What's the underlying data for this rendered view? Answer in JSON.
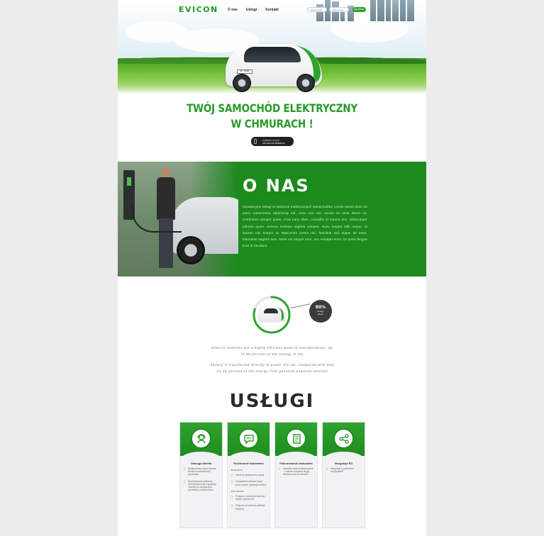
{
  "nav": {
    "logo": "EVICON",
    "menu": [
      "O nas",
      "Usługi",
      "Kontakt"
    ],
    "login_placeholder": "Nazwa użytk.",
    "password_placeholder": "Hasło użytk.",
    "login_button": "ZALOGUJ"
  },
  "hero": {
    "plate": "EV 8300",
    "headline_line1": "TWÓJ SAMOCHÓD ELEKTRYCZNY",
    "headline_line2": "W CHMURACH !",
    "app_button_line1": "POBIERZ NASZĄ",
    "app_button_line2": "APLIKACJĘ MOBILNĄ"
  },
  "about": {
    "title": "O NAS",
    "text": "Innowacyjne usługi w obszarze elektrycznych samochodów. Lorem ipsum dolor sit amet, consectetur adipiscing elit. Cras erat est, iaculis sit amet libero eu, vestibulum semper quam. Cras nunc diam, convallis at mauris nec, ullamcorper lobortis quam. Aenean tristique sagittis volutpat. Nunc feugiat nibh neque, ut laoreet nisi tempor ut. Maecenas metus dui, faucibus sed augue sit amet, bibendum sagittis sem. Nulla vel aliquet arcu, nec volutpat enim. Ut porta feugiat eros in tincidunt."
  },
  "gauge": {
    "percent": "80%",
    "label_line1": "energy",
    "label_line2": "saved",
    "fill_fraction": 0.8,
    "accent": "#2ea32e"
  },
  "ev_text": {
    "p1": "Electric vehicles are a highly efficient mode of transportation. Up to 80 percent of the energy in the",
    "p2": "battery is transferred directly to power the car, compared with only 14-26 percent of the energy from gasoline-powered vehicles"
  },
  "services": {
    "title": "USŁUGI",
    "cards": [
      {
        "icon": "headset-icon",
        "title": "Obsługa klienta",
        "items": [
          "Dedykowany zespół obsługi klienta od świadczonej sprzedaży",
          "Rozbudowana platforma internetowa wraz z aplikacją mobilną do zarządzania sprzedażą i rozliczeniami"
        ]
      },
      {
        "icon": "chat-icon",
        "title": "Rozliczanie ładowania",
        "subhead1": "B2B/B2C",
        "items1": [
          "Łatwe do podłączenia usługi",
          "Zarządzanie sieciami stacji przez portal i aplikacje mobilne"
        ],
        "subhead2": "ROAMING",
        "items2": [
          "Przyjęcie rozliczania klientów innych operatorów",
          "Płatności za pomocą aplikacji mobilnej"
        ]
      },
      {
        "icon": "invoice-icon",
        "title": "Fakturowanie ładowania",
        "items": [
          "Jednolity system fakturowania — faktura wysyłana drogą elektroniczną do klientów"
        ]
      },
      {
        "icon": "share-icon",
        "title": "Integracja EU",
        "items": [
          "Integracja z partnerami europejskimi"
        ]
      }
    ]
  }
}
